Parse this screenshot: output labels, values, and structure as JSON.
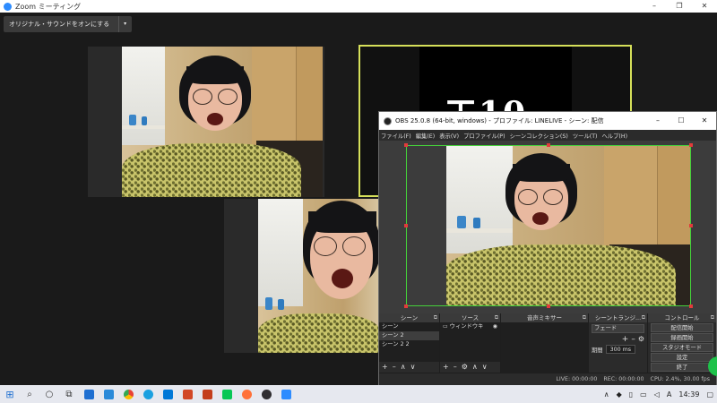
{
  "zoom": {
    "title": "Zoom ミーティング",
    "original_sound_button": "オリジナル・サウンドをオンにする",
    "chevron": "▾",
    "controls": [
      "–",
      "❐",
      "✕"
    ],
    "shared_screen_text": "工10"
  },
  "obs": {
    "title": "OBS 25.0.8 (64-bit, windows) - プロファイル: LINELIVE - シーン: 配信",
    "controls": [
      "–",
      "☐",
      "✕"
    ],
    "menu": [
      "ファイル(F)",
      "編集(E)",
      "表示(V)",
      "プロファイル(P)",
      "シーンコレクション(S)",
      "ツール(T)",
      "ヘルプ(H)"
    ],
    "docks": {
      "scenes": {
        "title": "シーン",
        "items": [
          "シーン",
          "シーン 2",
          "シーン 2 2"
        ],
        "selected_index": 1,
        "footer": [
          "+",
          "–",
          "∧",
          "∨"
        ]
      },
      "sources": {
        "title": "ソース",
        "items": [
          "ウィンドウキ"
        ],
        "footer": [
          "+",
          "–",
          "⚙",
          "∧",
          "∨"
        ]
      },
      "audio_mixer": {
        "title": "音声ミキサー"
      },
      "transitions": {
        "title": "シーントランジ...",
        "transition_value": "フェード",
        "duration_label": "期間",
        "duration_value": "300 ms",
        "buttons": [
          "+",
          "–",
          "⚙"
        ]
      },
      "controls": {
        "title": "コントロール",
        "buttons": [
          "配信開始",
          "録画開始",
          "スタジオモード",
          "設定",
          "終了"
        ]
      }
    },
    "status": {
      "live": "LIVE: 00:00:00",
      "rec": "REC: 00:00:00",
      "cpu": "CPU: 2.4%, 30.00 fps"
    }
  },
  "taskbar": {
    "icons": [
      "windows-start-icon",
      "search-icon",
      "cortana-icon",
      "task-view-icon",
      "mail-icon",
      "calendar-icon",
      "chrome-icon",
      "edge-icon",
      "store-icon",
      "powerpoint-icon",
      "photos-icon",
      "line-icon",
      "firefox-icon",
      "obs-icon",
      "zoom-icon"
    ],
    "tray": {
      "chevron": "∧",
      "clock": "14:39"
    }
  },
  "colors": {
    "accent_green": "#45d13a",
    "active_speaker": "#d6e05a",
    "handle_red": "#e23b3b",
    "zoom_bg": "#1a1a1a",
    "obs_bg": "#2b2b2b"
  }
}
